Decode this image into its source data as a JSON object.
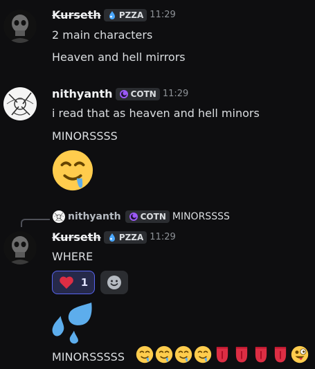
{
  "messages": [
    {
      "author": "Kurseth",
      "tag": "PZZA",
      "time": "11:29",
      "lines": [
        "2 main characters",
        "Heaven and hell mirrors"
      ]
    },
    {
      "author": "nithyanth",
      "tag": "COTN",
      "time": "11:29",
      "lines": [
        "i read that as heaven and hell minors",
        "MINORSSSS"
      ],
      "jumbo_emoji": "drooling-face"
    },
    {
      "reply_to": {
        "author": "nithyanth",
        "tag": "COTN",
        "text": "MINORSSSS"
      },
      "author": "Kurseth",
      "tag": "PZZA",
      "time": "11:29",
      "lines": [
        "WHERE"
      ],
      "reaction": {
        "emoji": "red-heart",
        "count": "1"
      },
      "jumbo_emoji": "sweat-droplets",
      "final_line": "MINORSSSSS",
      "trailing_emojis": [
        "drooling-face",
        "drooling-face",
        "drooling-face",
        "drooling-face",
        "tongue",
        "tongue",
        "tongue",
        "tongue",
        "zany-face"
      ]
    }
  ],
  "colors": {
    "background": "#0e0e10",
    "blurple": "#5865f2",
    "pzza_icon": "#4aa8ff",
    "cotn_icon": "#9b59f6"
  }
}
